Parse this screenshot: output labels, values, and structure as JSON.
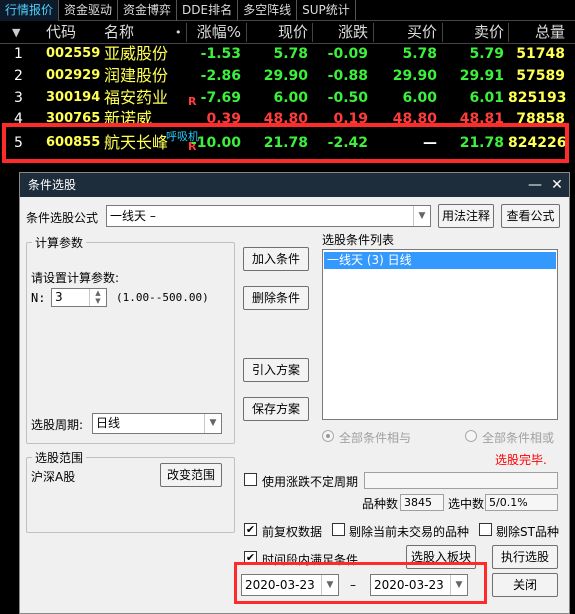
{
  "tabs": [
    "行情报价",
    "资金驱动",
    "资金博弈",
    "DDE排名",
    "多空阵线",
    "SUP统计"
  ],
  "table": {
    "headers": {
      "code": "代码",
      "name": "名称",
      "dot": "•",
      "change_pct": "涨幅%",
      "price": "现价",
      "change": "涨跌",
      "bid": "买价",
      "ask": "卖价",
      "volume": "总量"
    },
    "rows": [
      {
        "idx": "1",
        "code": "002559",
        "name": "亚威股份",
        "mark": "",
        "tag": "",
        "change_pct": "-1.53",
        "price": "5.78",
        "change": "-0.09",
        "bid": "5.78",
        "ask": "5.79",
        "volume": "51748"
      },
      {
        "idx": "2",
        "code": "002929",
        "name": "润建股份",
        "mark": "",
        "tag": "",
        "change_pct": "-2.86",
        "price": "29.90",
        "change": "-0.88",
        "bid": "29.90",
        "ask": "29.91",
        "volume": "57589"
      },
      {
        "idx": "3",
        "code": "300194",
        "name": "福安药业",
        "mark": "R",
        "tag": "",
        "change_pct": "-7.69",
        "price": "6.00",
        "change": "-0.50",
        "bid": "6.00",
        "ask": "6.01",
        "volume": "825193"
      },
      {
        "idx": "4",
        "code": "300765",
        "name": "新诺威",
        "mark": "",
        "tag": "",
        "change_pct": "0.39",
        "price": "48.80",
        "change": "0.19",
        "bid": "48.80",
        "ask": "48.81",
        "volume": "78858"
      },
      {
        "idx": "5",
        "code": "600855",
        "name": "航天长峰",
        "mark": "R",
        "tag": "呼吸机",
        "change_pct": "-10.00",
        "price": "21.78",
        "change": "-2.42",
        "bid": "—",
        "ask": "21.78",
        "volume": "824226"
      }
    ]
  },
  "dialog": {
    "title": "条件选股",
    "minimize": "—",
    "close": "✕",
    "formula_label": "条件选股公式",
    "formula_value": "一线天            –",
    "usage_btn": "用法注释",
    "view_btn": "查看公式",
    "calc_group_title": "计算参数",
    "set_params_label": "请设置计算参数:",
    "n_label": "N:",
    "n_value": "3",
    "n_range": "(1.00--500.00)",
    "period_label": "选股周期:",
    "period_value": "日线",
    "scope_group_title": "选股范围",
    "scope_value": "沪深A股",
    "change_scope_btn": "改变范围",
    "add_cond_btn": "加入条件",
    "del_cond_btn": "删除条件",
    "import_btn": "引入方案",
    "save_btn": "保存方案",
    "cond_list_label": "选股条件列表",
    "cond_items": [
      "一线天 (3) 日线"
    ],
    "radio_and": "全部条件相与",
    "radio_or": "全部条件相或",
    "status": "选股完毕.",
    "use_period_label": "使用涨跌不定周期",
    "count_label": "品种数",
    "count_value": "3845",
    "selected_label": "选中数",
    "selected_value": "5/0.1%",
    "fq_label": "前复权数据",
    "exclude_label": "剔除当前未交易的品种",
    "exclude_st_label": "剔除ST品种",
    "time_cond_label": "时间段内满足条件",
    "to_block_btn": "选股入板块",
    "run_btn": "执行选股",
    "date_from": "2020-03-23",
    "date_sep": "–",
    "date_to": "2020-03-23",
    "close_btn": "关闭",
    "check_mark": "✔"
  },
  "colors": {
    "up": "#ff3c3c",
    "down": "#3cf03c",
    "code": "#ffff54",
    "highlight_box": "#ff2a2a",
    "dialog_title_bg": "#1e2d3c",
    "list_selection": "#3399ff",
    "status_text": "#ff0000"
  }
}
